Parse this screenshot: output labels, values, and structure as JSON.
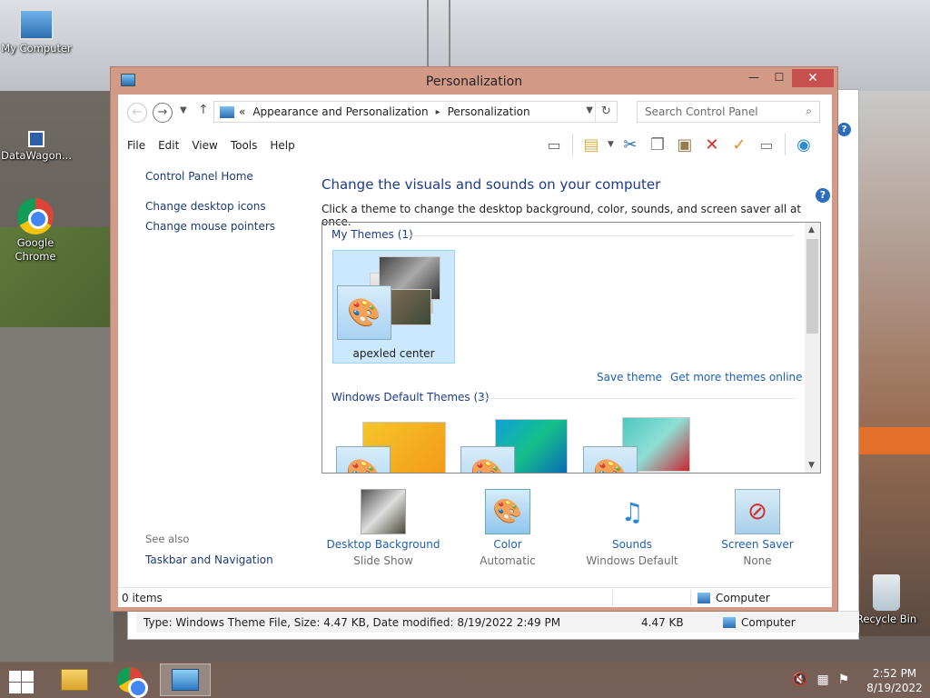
{
  "desktop": {
    "icons": [
      {
        "label": "My Computer"
      },
      {
        "label": "DataWagon..."
      },
      {
        "label": "Google Chrome"
      },
      {
        "label": "Recycle Bin"
      }
    ]
  },
  "background_window": {
    "status": {
      "file_info": "Type: Windows Theme File, Size: 4.47 KB, Date modified: 8/19/2022 2:49 PM",
      "size": "4.47 KB",
      "location": "Computer"
    }
  },
  "window": {
    "title": "Personalization",
    "controls": {
      "minimize": "—",
      "maximize": "☐",
      "close": "✕"
    },
    "address": {
      "prefix": "«",
      "segments": [
        "Appearance and Personalization",
        "Personalization"
      ]
    },
    "search_placeholder": "Search Control Panel",
    "menu": [
      "File",
      "Edit",
      "View",
      "Tools",
      "Help"
    ],
    "left_nav": {
      "items": [
        "Control Panel Home",
        "Change desktop icons",
        "Change mouse pointers"
      ],
      "see_also": "See also",
      "see_also_link": "Taskbar and Navigation"
    },
    "main": {
      "heading": "Change the visuals and sounds on your computer",
      "subheading": "Click a theme to change the desktop background, color, sounds, and screen saver all at once.",
      "my_themes_label": "My Themes (1)",
      "selected_theme": "apexled center",
      "save_theme": "Save theme",
      "get_more": "Get more themes online",
      "default_themes_label": "Windows Default Themes (3)"
    },
    "bottom_items": [
      {
        "label": "Desktop Background",
        "value": "Slide Show"
      },
      {
        "label": "Color",
        "value": "Automatic"
      },
      {
        "label": "Sounds",
        "value": "Windows Default"
      },
      {
        "label": "Screen Saver",
        "value": "None"
      }
    ],
    "status": {
      "count": "0 items",
      "location": "Computer"
    }
  },
  "taskbar": {
    "clock_time": "2:52 PM",
    "clock_date": "8/19/2022"
  },
  "colors": {
    "window_frame": "#d39a87",
    "close_button": "#c7504e",
    "link_blue": "#1e5fb0",
    "heading_blue": "#1e3a8a",
    "selection": "#cce8ff"
  }
}
